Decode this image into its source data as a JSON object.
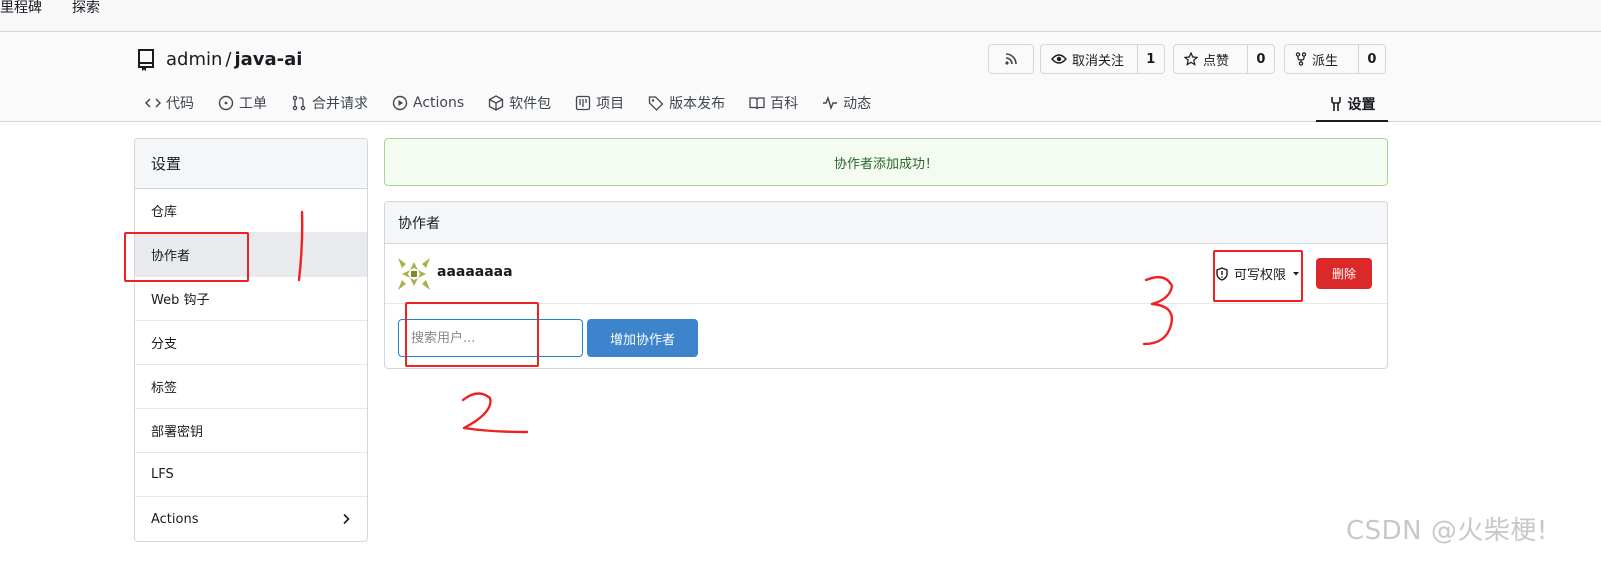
{
  "topnav": {
    "milestones": "里程碑",
    "explore": "探索"
  },
  "repo": {
    "owner": "admin",
    "separator": "/",
    "name": "java-ai"
  },
  "actions": {
    "unwatch_label": "取消关注",
    "unwatch_count": "1",
    "star_label": "点赞",
    "star_count": "0",
    "fork_label": "派生",
    "fork_count": "0"
  },
  "tabs": [
    {
      "label": "代码",
      "icon": "code-icon"
    },
    {
      "label": "工单",
      "icon": "issue-icon"
    },
    {
      "label": "合并请求",
      "icon": "pull-request-icon"
    },
    {
      "label": "Actions",
      "icon": "play-icon"
    },
    {
      "label": "软件包",
      "icon": "package-icon"
    },
    {
      "label": "项目",
      "icon": "project-icon"
    },
    {
      "label": "版本发布",
      "icon": "tag-icon"
    },
    {
      "label": "百科",
      "icon": "book-icon"
    },
    {
      "label": "动态",
      "icon": "pulse-icon"
    }
  ],
  "settings_tab": {
    "label": "设置",
    "icon": "tools-icon"
  },
  "sidebar": {
    "header": "设置",
    "items": [
      {
        "label": "仓库"
      },
      {
        "label": "协作者",
        "active": true
      },
      {
        "label": "Web 钩子"
      },
      {
        "label": "分支"
      },
      {
        "label": "标签"
      },
      {
        "label": "部署密钥"
      },
      {
        "label": "LFS"
      },
      {
        "label": "Actions",
        "has_chevron": true
      }
    ]
  },
  "flash": {
    "message": "协作者添加成功！",
    "color": "#2c662d"
  },
  "collaborators": {
    "header": "协作者",
    "rows": [
      {
        "username": "aaaaaaaa",
        "permission": "可写权限",
        "delete_label": "删除"
      }
    ],
    "search_placeholder": "搜索用户...",
    "add_label": "增加协作者"
  },
  "annotations": {
    "one": "1",
    "two": "2",
    "three": "3",
    "color": "#ee2222"
  },
  "watermark": "CSDN @火柴梗!"
}
